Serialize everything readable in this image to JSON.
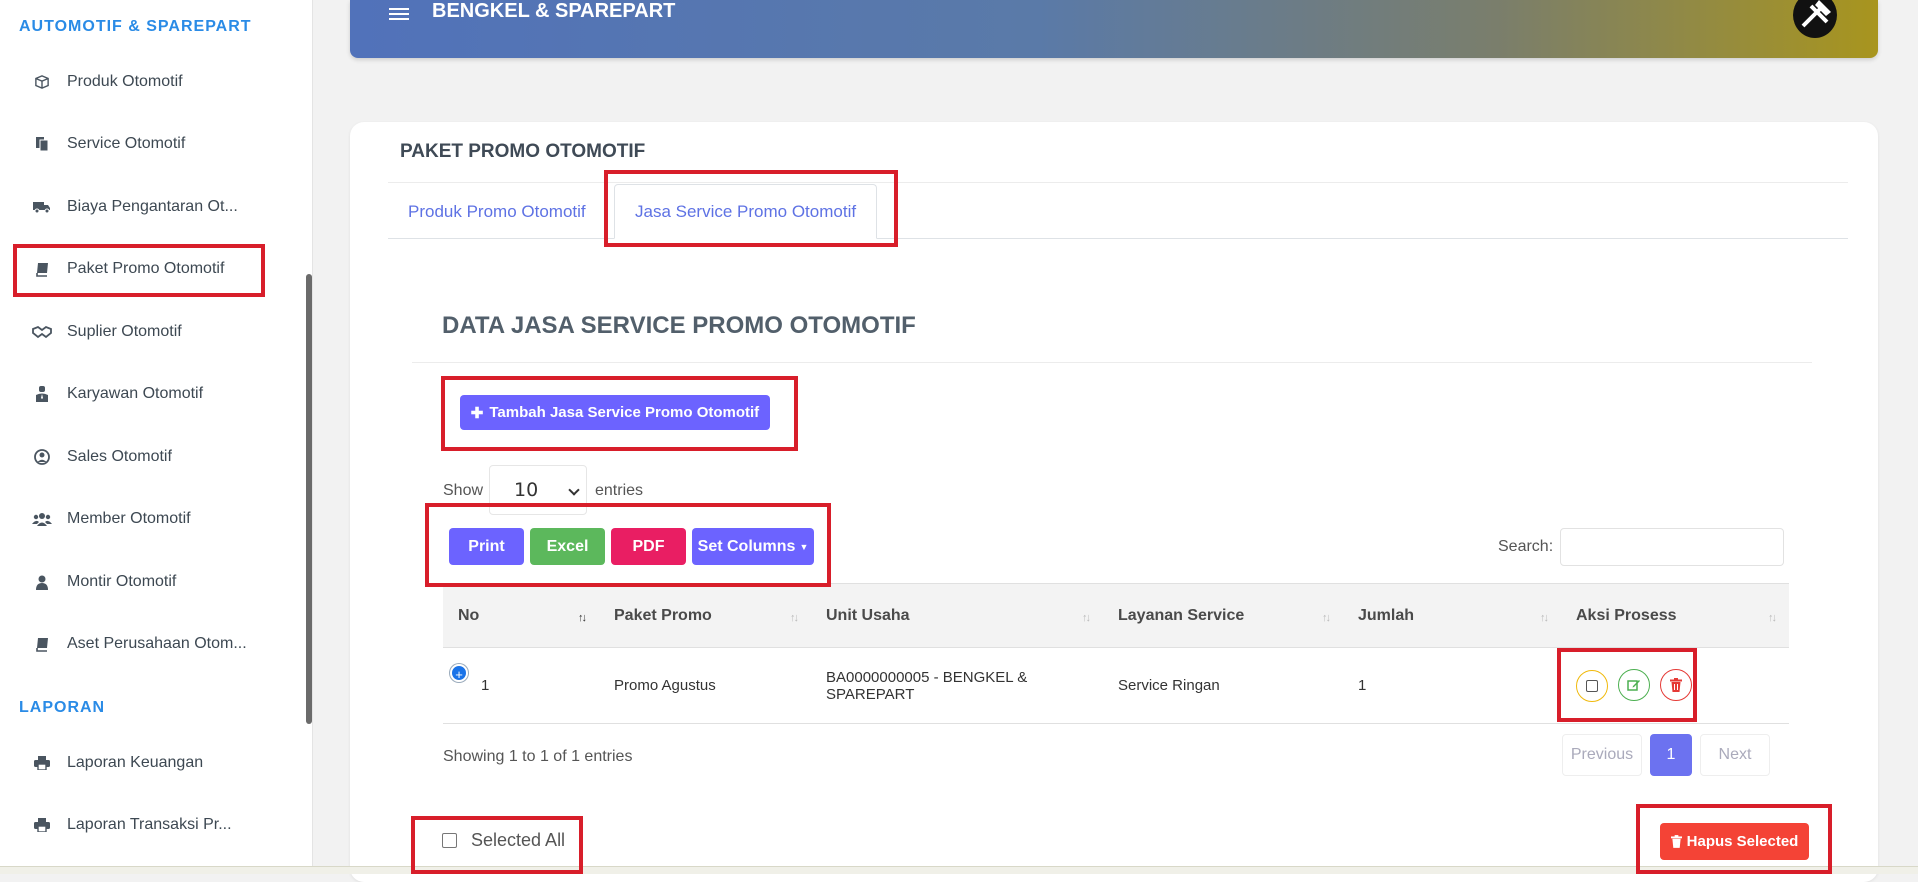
{
  "sidebar": {
    "heading_automotif": "AUTOMOTIF & SPAREPART",
    "heading_laporan": "LAPORAN",
    "items": [
      {
        "label": "Produk Otomotif",
        "icon": "box-icon"
      },
      {
        "label": "Service Otomotif",
        "icon": "files-icon"
      },
      {
        "label": "Biaya Pengantaran Ot...",
        "icon": "truck-icon"
      },
      {
        "label": "Paket Promo Otomotif",
        "icon": "book-icon"
      },
      {
        "label": "Suplier Otomotif",
        "icon": "handshake-icon"
      },
      {
        "label": "Karyawan Otomotif",
        "icon": "user-tie-icon"
      },
      {
        "label": "Sales Otomotif",
        "icon": "user-circle-icon"
      },
      {
        "label": "Member Otomotif",
        "icon": "users-icon"
      },
      {
        "label": "Montir Otomotif",
        "icon": "user-icon"
      },
      {
        "label": "Aset Perusahaan Otom...",
        "icon": "book-icon"
      }
    ],
    "laporan_items": [
      {
        "label": "Laporan Keuangan",
        "icon": "printer-icon"
      },
      {
        "label": "Laporan Transaksi Pr...",
        "icon": "printer-icon"
      }
    ]
  },
  "topbar": {
    "brand": "BENGKEL & SPAREPART"
  },
  "card": {
    "title": "PAKET PROMO OTOMOTIF",
    "tabs": [
      "Produk Promo Otomotif",
      "Jasa Service Promo Otomotif"
    ],
    "section_title": "DATA JASA SERVICE PROMO OTOMOTIF",
    "add_button": "Tambah Jasa Service Promo Otomotif",
    "show_label": "Show",
    "entries_value": "10",
    "entries_label": "entries",
    "export_buttons": {
      "print": "Print",
      "excel": "Excel",
      "pdf": "PDF",
      "columns": "Set Columns"
    },
    "search_label": "Search:",
    "table": {
      "headers": [
        "No",
        "Paket Promo",
        "Unit Usaha",
        "Layanan Service",
        "Jumlah",
        "Aksi Prosess"
      ],
      "rows": [
        {
          "no": "1",
          "paket_promo": "Promo Agustus",
          "unit_usaha_line1": "BA0000000005 - BENGKEL &",
          "unit_usaha_line2": "SPAREPART",
          "layanan_service": "Service Ringan",
          "jumlah": "1"
        }
      ]
    },
    "info": "Showing 1 to 1 of 1 entries",
    "pagination": {
      "previous": "Previous",
      "current": "1",
      "next": "Next"
    },
    "selected_all": "Selected All",
    "delete_selected": "Hapus Selected"
  },
  "colors": {
    "accent": "#5e72e4",
    "highlight_box": "#d81e2a",
    "sidebar_heading": "#2a8be6",
    "print": "#6c63ff",
    "excel": "#5cb85c",
    "pdf": "#e91e63",
    "delete": "#f44336"
  }
}
